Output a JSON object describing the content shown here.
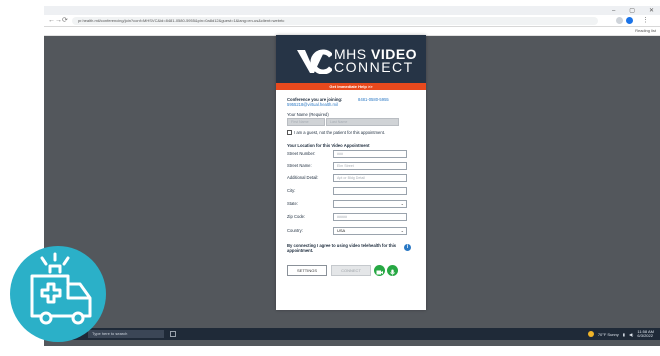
{
  "browser": {
    "url": "pr.health.mil/conferencing/join?conf=MHSVC&id=8481-0580-5955&pin=0a8d12&guest=1&lang=en-us&client=webrtc",
    "reading_list": "Reading list",
    "win_controls": [
      "–",
      "▢",
      "✕"
    ]
  },
  "card": {
    "brand_line1_a": "MHS ",
    "brand_line1_b": "VIDEO",
    "brand_line2": "CONNECT",
    "help_bar": "Get Immediate Help >>",
    "conference_label": "Conference you are joining:",
    "conference_id": "8481-0580-5955",
    "conference_domain": "5955218@virtual.health.mil",
    "name_label": "Your Name (Required)",
    "first_name": "First Name",
    "last_name": "Last Name",
    "guest_label": "I am a guest, not the patient for this appointment.",
    "location_heading": "Your Location for this Video Appointment",
    "fields": [
      {
        "label": "Street Number:",
        "placeholder": "###"
      },
      {
        "label": "Street Name:",
        "placeholder": "Elm Street"
      },
      {
        "label": "Additional Detail:",
        "placeholder": "Apt or Bldg Detail"
      },
      {
        "label": "City:",
        "placeholder": ""
      },
      {
        "label": "State:",
        "placeholder": ""
      },
      {
        "label": "Zip Code:",
        "placeholder": "#####"
      },
      {
        "label": "Country:",
        "placeholder": "USA"
      }
    ],
    "consent": "By connecting I agree to using video telehealth for this appointment.",
    "settings_button": "SETTINGS",
    "connect_button": "CONNECT"
  },
  "taskbar": {
    "search": "Type here to search",
    "weather": "70°F Sunny",
    "time": "11:58 AM",
    "date": "6/3/2022"
  },
  "colors": {
    "header": "#263446",
    "help": "#e8491d",
    "badge": "#2bb0c8",
    "accent": "#2a78c4",
    "success": "#27a844"
  }
}
